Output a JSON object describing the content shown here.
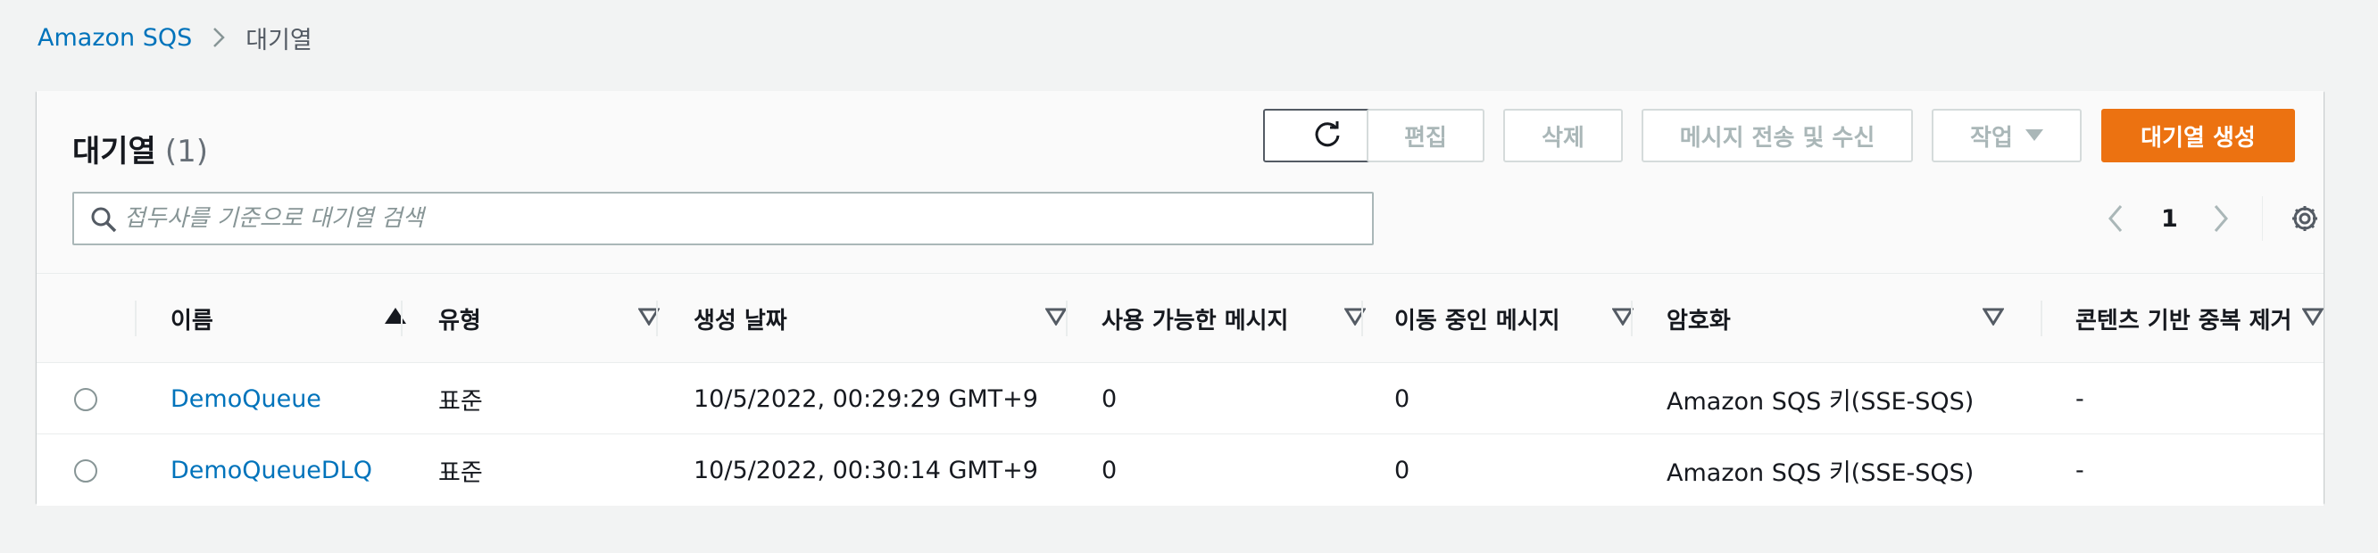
{
  "breadcrumb": {
    "root": "Amazon SQS",
    "current": "대기열"
  },
  "header": {
    "title": "대기열",
    "count": "(1)"
  },
  "toolbar": {
    "edit_label": "편집",
    "delete_label": "삭제",
    "send_receive_label": "메시지 전송 및 수신",
    "actions_label": "작업",
    "create_label": "대기열 생성"
  },
  "search": {
    "placeholder": "접두사를 기준으로 대기열 검색",
    "value": ""
  },
  "pagination": {
    "current_page": "1"
  },
  "table": {
    "columns": [
      {
        "label": "이름",
        "sort": "ascending"
      },
      {
        "label": "유형",
        "sort": "none"
      },
      {
        "label": "생성 날짜",
        "sort": "none"
      },
      {
        "label": "사용 가능한 메시지",
        "sort": "none"
      },
      {
        "label": "이동 중인 메시지",
        "sort": "none"
      },
      {
        "label": "암호화",
        "sort": "none"
      },
      {
        "label": "콘텐츠 기반 중복 제거",
        "sort": "none"
      }
    ],
    "rows": [
      {
        "selected": false,
        "name": "DemoQueue",
        "type": "표준",
        "created": "10/5/2022, 00:29:29 GMT+9",
        "available": "0",
        "in_flight": "0",
        "encryption": "Amazon SQS 키(SSE-SQS)",
        "dedup": "-"
      },
      {
        "selected": false,
        "name": "DemoQueueDLQ",
        "type": "표준",
        "created": "10/5/2022, 00:30:14 GMT+9",
        "available": "0",
        "in_flight": "0",
        "encryption": "Amazon SQS 키(SSE-SQS)",
        "dedup": "-"
      }
    ]
  },
  "colors": {
    "link": "#0073bb",
    "primary": "#ec7211",
    "background": "#f2f3f3",
    "disabled_text": "#aab7b8"
  },
  "icons": {
    "breadcrumb_separator": "chevron-right-icon",
    "refresh": "refresh-icon",
    "actions_dropdown": "caret-down-icon",
    "search": "search-icon",
    "prev_page": "chevron-left-icon",
    "next_page": "chevron-right-icon",
    "settings": "gear-icon",
    "sort_asc": "sort-ascending-icon",
    "sort_none": "sort-unsorted-icon"
  }
}
